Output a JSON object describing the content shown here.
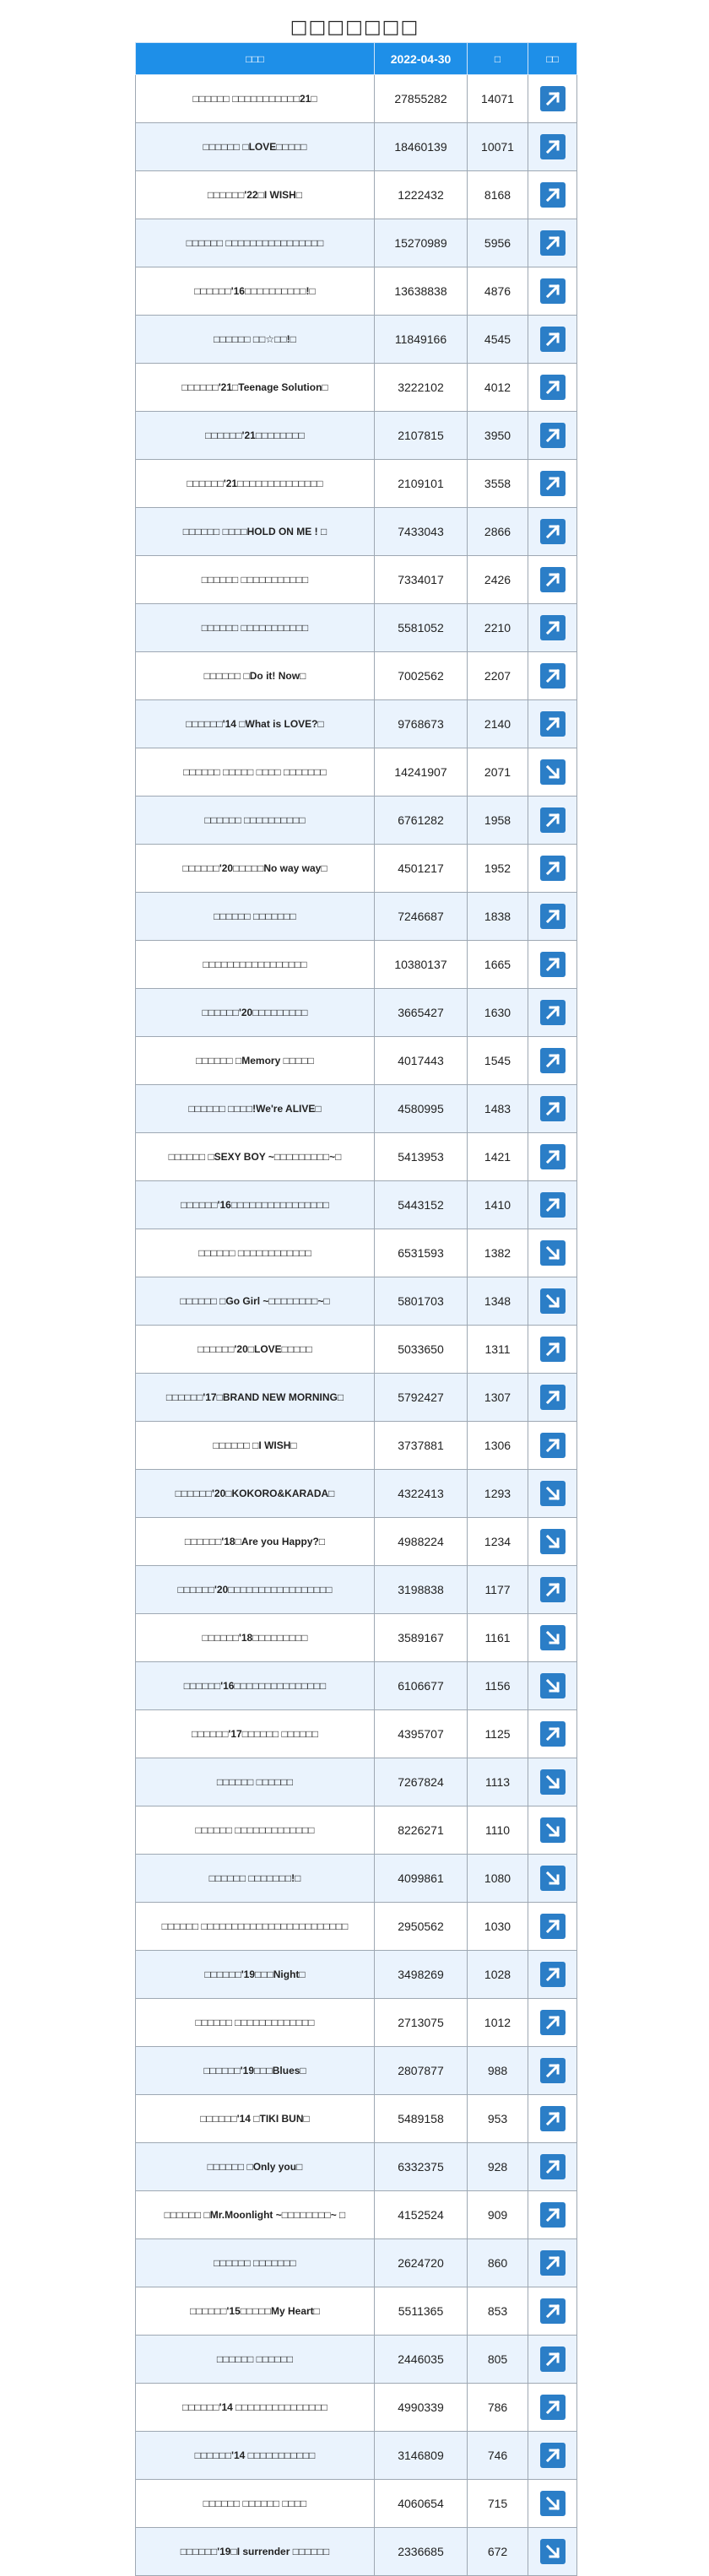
{
  "page": {
    "title": "□□□□□□□"
  },
  "table": {
    "headers": [
      "□□□",
      "2022-04-30",
      "□",
      "□□"
    ],
    "rows": [
      {
        "name": "□□□□□□ □□□□□□□□□□□21□",
        "views": "27855282",
        "change": "14071",
        "trend": "up"
      },
      {
        "name": "□□□□□□ □LOVE□□□□□",
        "views": "18460139",
        "change": "10071",
        "trend": "up"
      },
      {
        "name": "□□□□□□'22□I WISH□",
        "views": "1222432",
        "change": "8168",
        "trend": "up"
      },
      {
        "name": "□□□□□□ □□□□□□□□□□□□□□□□",
        "views": "15270989",
        "change": "5956",
        "trend": "up"
      },
      {
        "name": "□□□□□□'16□□□□□□□□□□!□",
        "views": "13638838",
        "change": "4876",
        "trend": "up"
      },
      {
        "name": "□□□□□□ □□☆□□!□",
        "views": "11849166",
        "change": "4545",
        "trend": "up"
      },
      {
        "name": "□□□□□□'21□Teenage Solution□",
        "views": "3222102",
        "change": "4012",
        "trend": "up"
      },
      {
        "name": "□□□□□□'21□□□□□□□□",
        "views": "2107815",
        "change": "3950",
        "trend": "up"
      },
      {
        "name": "□□□□□□'21□□□□□□□□□□□□□□",
        "views": "2109101",
        "change": "3558",
        "trend": "up"
      },
      {
        "name": "□□□□□□ □□□□HOLD ON ME ! □",
        "views": "7433043",
        "change": "2866",
        "trend": "up"
      },
      {
        "name": "□□□□□□ □□□□□□□□□□□",
        "views": "7334017",
        "change": "2426",
        "trend": "up"
      },
      {
        "name": "□□□□□□ □□□□□□□□□□□",
        "views": "5581052",
        "change": "2210",
        "trend": "up"
      },
      {
        "name": "□□□□□□ □Do it! Now□",
        "views": "7002562",
        "change": "2207",
        "trend": "up"
      },
      {
        "name": "□□□□□□'14 □What is LOVE?□",
        "views": "9768673",
        "change": "2140",
        "trend": "up"
      },
      {
        "name": "□□□□□□ □□□□□ □□□□ □□□□□□□",
        "views": "14241907",
        "change": "2071",
        "trend": "down"
      },
      {
        "name": "□□□□□□ □□□□□□□□□□",
        "views": "6761282",
        "change": "1958",
        "trend": "up"
      },
      {
        "name": "□□□□□□'20□□□□□No way way□",
        "views": "4501217",
        "change": "1952",
        "trend": "up"
      },
      {
        "name": "□□□□□□ □□□□□□□",
        "views": "7246687",
        "change": "1838",
        "trend": "up"
      },
      {
        "name": "□□□□□□□□□□□□□□□□□",
        "views": "10380137",
        "change": "1665",
        "trend": "up"
      },
      {
        "name": "□□□□□□'20□□□□□□□□□",
        "views": "3665427",
        "change": "1630",
        "trend": "up"
      },
      {
        "name": "□□□□□□ □Memory □□□□□",
        "views": "4017443",
        "change": "1545",
        "trend": "up"
      },
      {
        "name": "□□□□□□ □□□□!We're ALIVE□",
        "views": "4580995",
        "change": "1483",
        "trend": "up"
      },
      {
        "name": "□□□□□□ □SEXY BOY ~□□□□□□□□□~□",
        "views": "5413953",
        "change": "1421",
        "trend": "up"
      },
      {
        "name": "□□□□□□'16□□□□□□□□□□□□□□□□",
        "views": "5443152",
        "change": "1410",
        "trend": "up"
      },
      {
        "name": "□□□□□□ □□□□□□□□□□□□",
        "views": "6531593",
        "change": "1382",
        "trend": "down"
      },
      {
        "name": "□□□□□□ □Go Girl ~□□□□□□□□~□",
        "views": "5801703",
        "change": "1348",
        "trend": "down"
      },
      {
        "name": "□□□□□□'20□LOVE□□□□□",
        "views": "5033650",
        "change": "1311",
        "trend": "up"
      },
      {
        "name": "□□□□□□'17□BRAND NEW MORNING□",
        "views": "5792427",
        "change": "1307",
        "trend": "up"
      },
      {
        "name": "□□□□□□ □I WISH□",
        "views": "3737881",
        "change": "1306",
        "trend": "up"
      },
      {
        "name": "□□□□□□'20□KOKORO&KARADA□",
        "views": "4322413",
        "change": "1293",
        "trend": "down"
      },
      {
        "name": "□□□□□□'18□Are you Happy?□",
        "views": "4988224",
        "change": "1234",
        "trend": "down"
      },
      {
        "name": "□□□□□□'20□□□□□□□□□□□□□□□□□",
        "views": "3198838",
        "change": "1177",
        "trend": "up"
      },
      {
        "name": "□□□□□□'18□□□□□□□□□",
        "views": "3589167",
        "change": "1161",
        "trend": "down"
      },
      {
        "name": "□□□□□□'16□□□□□□□□□□□□□□□",
        "views": "6106677",
        "change": "1156",
        "trend": "down"
      },
      {
        "name": "□□□□□□'17□□□□□□ □□□□□□",
        "views": "4395707",
        "change": "1125",
        "trend": "up"
      },
      {
        "name": "□□□□□□ □□□□□□",
        "views": "7267824",
        "change": "1113",
        "trend": "down"
      },
      {
        "name": "□□□□□□ □□□□□□□□□□□□□",
        "views": "8226271",
        "change": "1110",
        "trend": "down"
      },
      {
        "name": "□□□□□□ □□□□□□□!□",
        "views": "4099861",
        "change": "1080",
        "trend": "down"
      },
      {
        "name": "□□□□□□ □□□□□□□□□□□□□□□□□□□□□□□□",
        "views": "2950562",
        "change": "1030",
        "trend": "up"
      },
      {
        "name": "□□□□□□'19□□□Night□",
        "views": "3498269",
        "change": "1028",
        "trend": "up"
      },
      {
        "name": "□□□□□□ □□□□□□□□□□□□□",
        "views": "2713075",
        "change": "1012",
        "trend": "up"
      },
      {
        "name": "□□□□□□'19□□□Blues□",
        "views": "2807877",
        "change": "988",
        "trend": "up"
      },
      {
        "name": "□□□□□□'14 □TIKI BUN□",
        "views": "5489158",
        "change": "953",
        "trend": "up"
      },
      {
        "name": "□□□□□□ □Only you□",
        "views": "6332375",
        "change": "928",
        "trend": "up"
      },
      {
        "name": "□□□□□□ □Mr.Moonlight ~□□□□□□□□~ □",
        "views": "4152524",
        "change": "909",
        "trend": "up"
      },
      {
        "name": "□□□□□□ □□□□□□□",
        "views": "2624720",
        "change": "860",
        "trend": "up"
      },
      {
        "name": "□□□□□□'15□□□□□My Heart□",
        "views": "5511365",
        "change": "853",
        "trend": "up"
      },
      {
        "name": "□□□□□□ □□□□□□",
        "views": "2446035",
        "change": "805",
        "trend": "up"
      },
      {
        "name": "□□□□□□'14 □□□□□□□□□□□□□□□",
        "views": "4990339",
        "change": "786",
        "trend": "up"
      },
      {
        "name": "□□□□□□'14 □□□□□□□□□□□",
        "views": "3146809",
        "change": "746",
        "trend": "up"
      },
      {
        "name": "□□□□□□ □□□□□□ □□□□",
        "views": "4060654",
        "change": "715",
        "trend": "down"
      },
      {
        "name": "□□□□□□'19□I surrender □□□□□□",
        "views": "2336685",
        "change": "672",
        "trend": "down"
      }
    ]
  }
}
